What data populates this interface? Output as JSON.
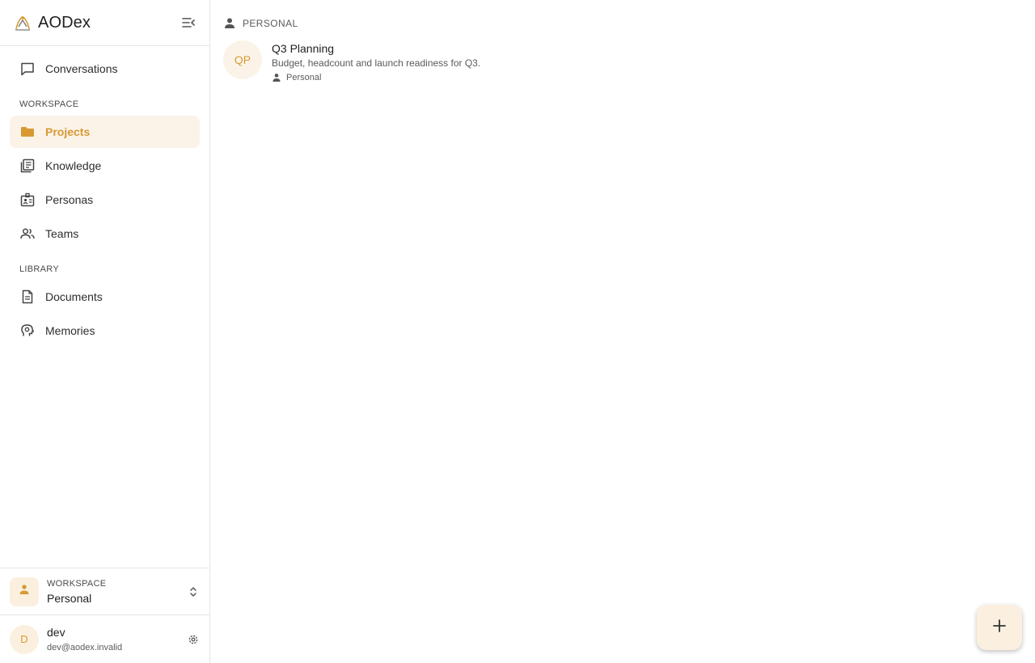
{
  "app": {
    "title": "AODex",
    "logo_icon": "bird-logo-icon"
  },
  "theme": {
    "accent": "#d79a33",
    "accent_bg": "#fbf3e8"
  },
  "sidebar": {
    "top_item": {
      "label": "Conversations",
      "icon": "chat-icon"
    },
    "sections": [
      {
        "label": "WORKSPACE",
        "items": [
          {
            "label": "Projects",
            "icon": "folder-icon",
            "active": true
          },
          {
            "label": "Knowledge",
            "icon": "library-icon"
          },
          {
            "label": "Personas",
            "icon": "badge-icon"
          },
          {
            "label": "Teams",
            "icon": "group-icon"
          }
        ]
      },
      {
        "label": "LIBRARY",
        "items": [
          {
            "label": "Documents",
            "icon": "document-icon"
          },
          {
            "label": "Memories",
            "icon": "brain-icon"
          }
        ]
      }
    ],
    "workspace": {
      "label": "WORKSPACE",
      "name": "Personal"
    },
    "user": {
      "initial": "D",
      "name": "dev",
      "email": "dev@aodex.invalid"
    }
  },
  "main": {
    "group": {
      "title": "PERSONAL"
    },
    "projects": [
      {
        "initials": "QP",
        "title": "Q3 Planning",
        "description": "Budget, headcount and launch readiness for Q3.",
        "tag": "Personal"
      }
    ]
  }
}
